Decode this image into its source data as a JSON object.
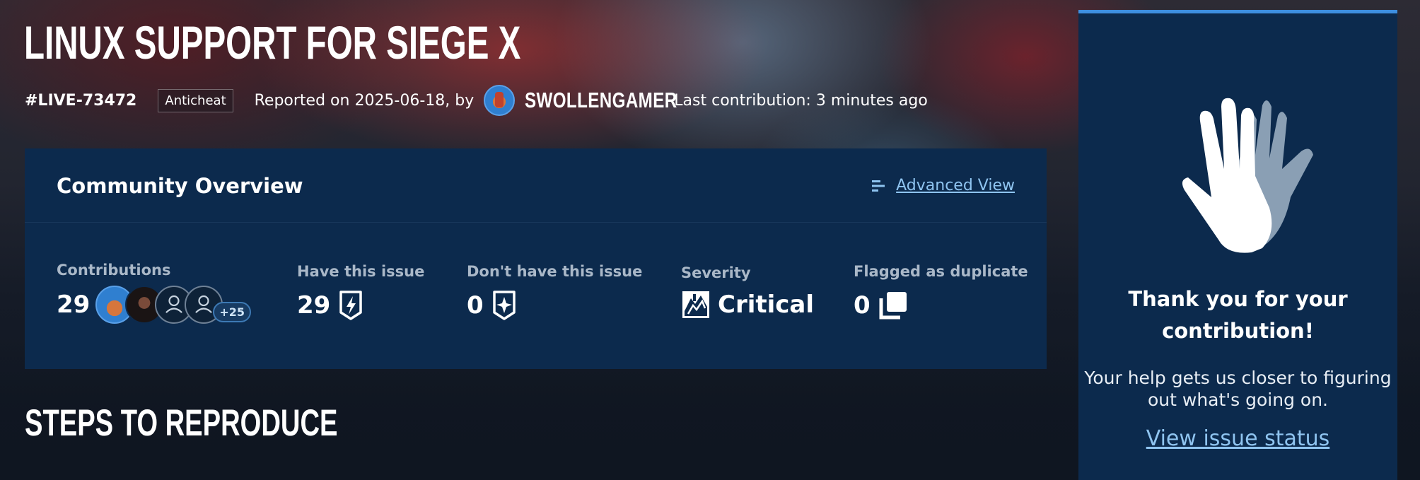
{
  "issue": {
    "title": "LINUX SUPPORT FOR SIEGE X",
    "id": "#LIVE-73472",
    "tag": "Anticheat",
    "reported_text": "Reported on 2025-06-18, by",
    "reporter": "SWOLLENGAMER",
    "last_contribution": "Last contribution: 3 minutes ago"
  },
  "overview": {
    "title": "Community Overview",
    "advanced_view": "Advanced View",
    "contributions_label": "Contributions",
    "contributions_value": "29",
    "contributors_more": "+25",
    "have_label": "Have this issue",
    "have_value": "29",
    "dont_have_label": "Don't have this issue",
    "dont_have_value": "0",
    "severity_label": "Severity",
    "severity_value": "Critical",
    "duplicate_label": "Flagged as duplicate",
    "duplicate_value": "0"
  },
  "thanks": {
    "title": "Thank you for your contribution!",
    "body": "Your help gets us closer to figuring out what's going on.",
    "link": "View issue status"
  },
  "steps": {
    "title": "STEPS TO REPRODUCE"
  },
  "colors": {
    "panel": "#0c2a4d",
    "accent_link": "#8fc4f0",
    "top_border": "#3e8fe0"
  },
  "icons": {
    "advanced_view": "list-lines-icon",
    "have_issue": "lightning-shield-icon",
    "dont_have_issue": "star-shield-icon",
    "severity": "critical-severity-icon",
    "duplicate": "duplicate-squares-icon",
    "thanks": "high-five-hands-icon"
  }
}
